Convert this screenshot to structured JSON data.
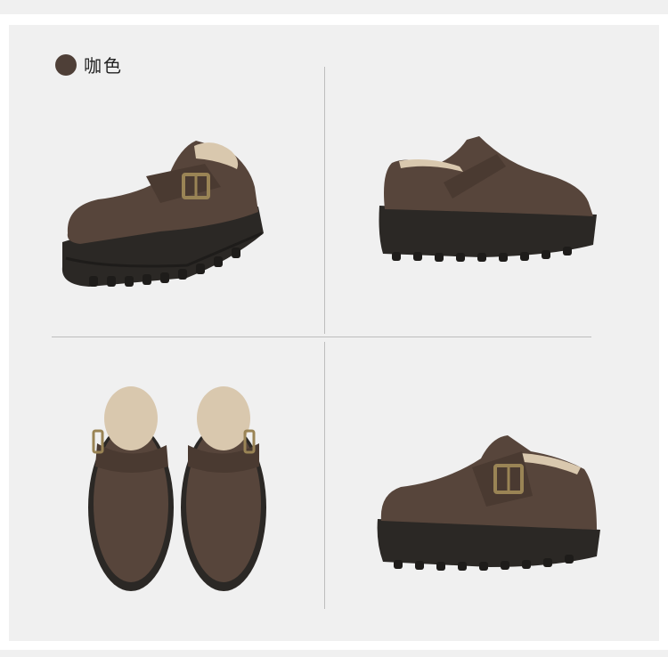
{
  "color_option": {
    "label": "咖色",
    "swatch_color": "#4e3f37"
  },
  "product_views": [
    {
      "id": "front-three-quarter",
      "icon": "shoe-photo"
    },
    {
      "id": "side",
      "icon": "shoe-photo"
    },
    {
      "id": "top-pair",
      "icon": "shoe-photo"
    },
    {
      "id": "three-quarter-right",
      "icon": "shoe-photo"
    }
  ],
  "colors": {
    "suede": "#57453b",
    "suede_dark": "#3e3029",
    "sole": "#2b2825",
    "fur": "#d9c8ae",
    "buckle": "#9a8455",
    "background": "#f0f0f0"
  }
}
